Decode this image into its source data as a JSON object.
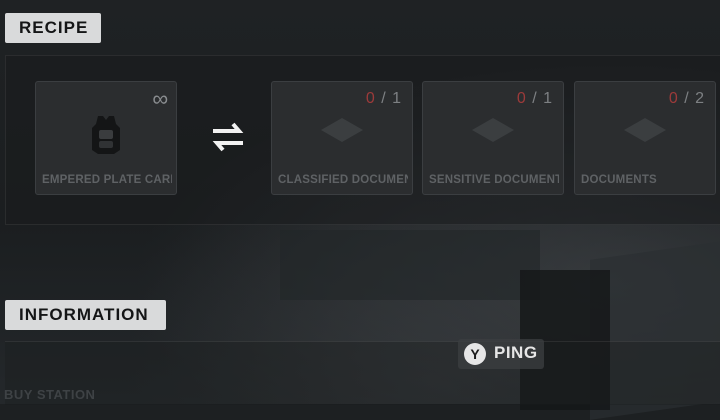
{
  "recipe": {
    "title": "RECIPE",
    "result": {
      "name": "EMPERED PLATE CARRIER",
      "quantity": "∞",
      "icon": "plate-carrier-icon"
    },
    "swap_icon": "swap-arrows-icon",
    "ingredients": [
      {
        "name": "CLASSIFIED DOCUMENTS",
        "have": "0",
        "need": "1"
      },
      {
        "name": "SENSITIVE DOCUMENTS",
        "have": "0",
        "need": "1"
      },
      {
        "name": "DOCUMENTS",
        "have": "0",
        "need": "2"
      }
    ]
  },
  "information": {
    "title": "INFORMATION",
    "station_label": "BUY STATION"
  },
  "ping": {
    "button": "Y",
    "label": "PING"
  },
  "colors": {
    "missing_count": "#9c3a3a",
    "tag_bg": "#d9dadb"
  }
}
